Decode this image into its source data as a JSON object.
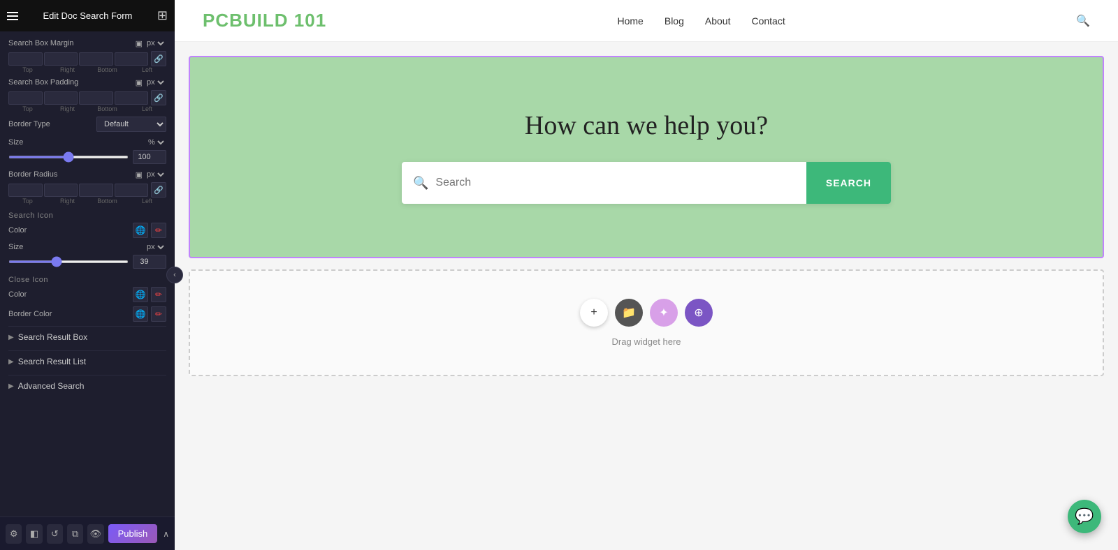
{
  "panel": {
    "title": "Edit Doc Search Form",
    "sections": {
      "searchBoxMargin": {
        "label": "Search Box Margin",
        "unit": "px",
        "fields": {
          "top": "",
          "right": "",
          "bottom": "",
          "left": ""
        },
        "labels": [
          "Top",
          "Right",
          "Bottom",
          "Left"
        ]
      },
      "searchBoxPadding": {
        "label": "Search Box Padding",
        "unit": "px",
        "fields": {
          "top": "",
          "right": "",
          "bottom": "",
          "left": ""
        },
        "labels": [
          "Top",
          "Right",
          "Bottom",
          "Left"
        ]
      },
      "borderType": {
        "label": "Border Type",
        "options": [
          "Default"
        ]
      },
      "size": {
        "label": "Size",
        "unit": "%",
        "value": 100,
        "min": 0,
        "max": 200
      },
      "borderRadius": {
        "label": "Border Radius",
        "unit": "px",
        "fields": {
          "top": "",
          "right": "",
          "bottom": "",
          "left": ""
        },
        "labels": [
          "Top",
          "Right",
          "Bottom",
          "Left"
        ]
      },
      "searchIcon": {
        "label": "Search Icon",
        "color": {
          "label": "Color"
        },
        "size": {
          "label": "Size",
          "unit": "px",
          "value": 39,
          "min": 0,
          "max": 100
        }
      },
      "closeIcon": {
        "label": "Close Icon",
        "color": {
          "label": "Color"
        },
        "borderColor": {
          "label": "Border Color"
        }
      }
    },
    "collapsibles": [
      {
        "label": "Search Result Box",
        "id": "search-result-box"
      },
      {
        "label": "Search Result List",
        "id": "search-result-list"
      },
      {
        "label": "Advanced Search",
        "id": "advanced-search"
      }
    ],
    "footer": {
      "icons": [
        "⚙",
        "◧",
        "↺",
        "⧉",
        "👁"
      ],
      "publish": "Publish"
    }
  },
  "site": {
    "logo": "PCBUILD 101",
    "nav": [
      "Home",
      "Blog",
      "About",
      "Contact"
    ]
  },
  "hero": {
    "heading": "How can we help you?",
    "search": {
      "placeholder": "Search",
      "button": "SEARCH"
    }
  },
  "dropzone": {
    "label": "Drag widget here"
  },
  "colors": {
    "accent": "#3db87a",
    "brand": "#6dbf6d",
    "purple": "#7b55c4",
    "heroBackground": "#a8d8a8",
    "heroBorder": "#c084fc"
  }
}
